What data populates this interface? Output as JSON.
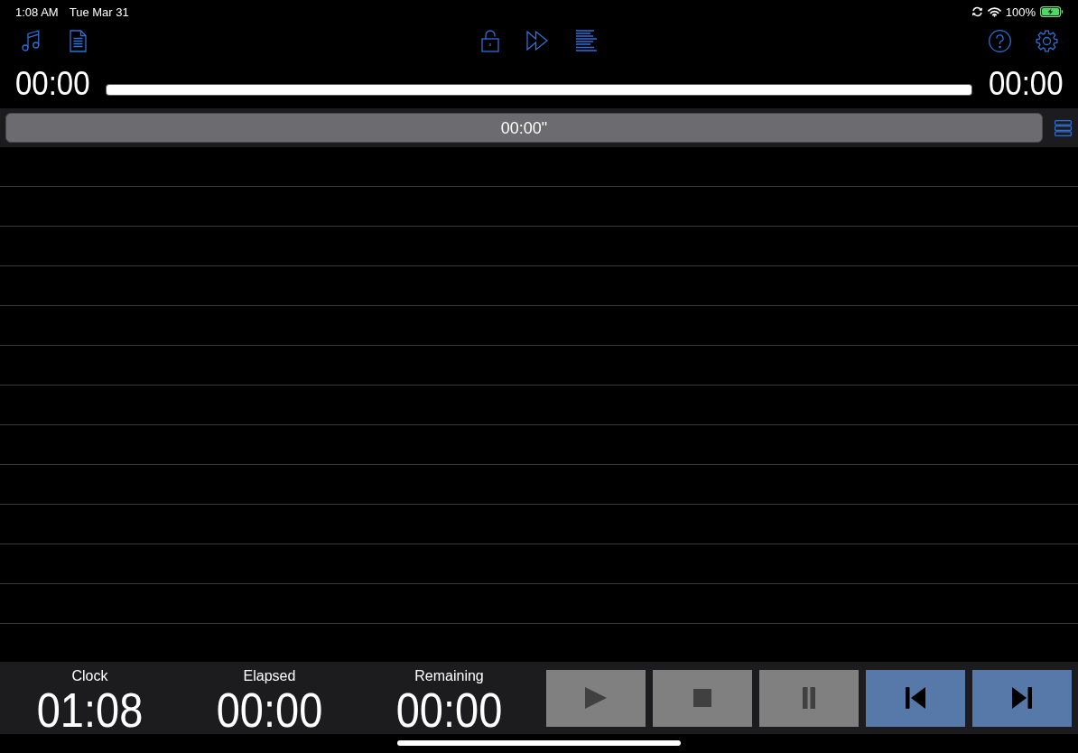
{
  "status_bar": {
    "time": "1:08 AM",
    "date": "Tue Mar 31",
    "battery_percent": "100%",
    "charging": true
  },
  "time_row": {
    "elapsed": "00:00",
    "progress": {
      "level": 1
    },
    "remaining": "00:00"
  },
  "cue_bar": {
    "duration": "00:00\""
  },
  "timers": [
    {
      "label": "Clock",
      "value": "01:08"
    },
    {
      "label": "Elapsed",
      "value": "00:00"
    },
    {
      "label": "Remaining",
      "value": "00:00"
    }
  ],
  "transport_buttons": [
    {
      "kind": "play",
      "disabled": true
    },
    {
      "kind": "stop",
      "disabled": true
    },
    {
      "kind": "pause",
      "disabled": true
    },
    {
      "kind": "previous",
      "disabled": false
    },
    {
      "kind": "next",
      "disabled": false
    }
  ]
}
